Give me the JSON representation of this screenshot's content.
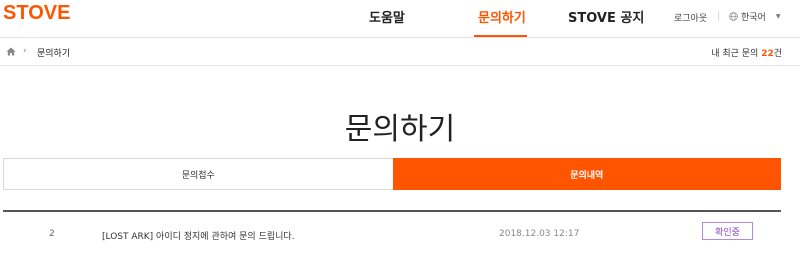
{
  "header": {
    "logo": "STOVE",
    "nav": [
      {
        "label": "도움말"
      },
      {
        "label": "문의하기"
      },
      {
        "label": "STOVE 공지"
      }
    ],
    "logout_label": "로그아웃",
    "language_label": "한국어",
    "accent_color": "#ff5400"
  },
  "breadcrumb": {
    "current": "문의하기",
    "recent_prefix": "내 최근 문의 ",
    "recent_count": "22",
    "recent_suffix": "건"
  },
  "page": {
    "title": "문의하기",
    "tabs": [
      {
        "label": "문의접수",
        "active": false
      },
      {
        "label": "문의내역",
        "active": true
      }
    ]
  },
  "inquiries": [
    {
      "no": "2",
      "subject": "[LOST ARK] 아이디 정지에 관하여 문의 드립니다.",
      "date": "2018.12.03  12:17",
      "status": "확인중"
    }
  ]
}
